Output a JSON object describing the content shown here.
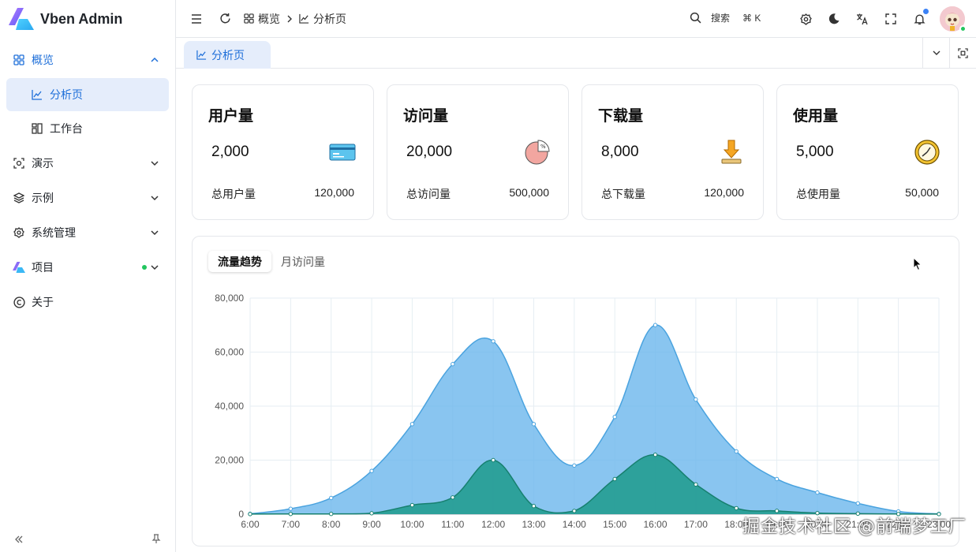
{
  "brand": {
    "title": "Vben Admin"
  },
  "sidebar": {
    "items": [
      {
        "label": "概览",
        "icon": "grid-icon",
        "open": true
      },
      {
        "label": "分析页",
        "icon": "chart-line-icon",
        "active": true
      },
      {
        "label": "工作台",
        "icon": "workspace-icon"
      },
      {
        "label": "演示",
        "icon": "demo-icon"
      },
      {
        "label": "示例",
        "icon": "layers-icon"
      },
      {
        "label": "系统管理",
        "icon": "gear-icon"
      },
      {
        "label": "项目",
        "icon": "vben-logo-icon"
      },
      {
        "label": "关于",
        "icon": "copyright-icon"
      }
    ]
  },
  "header": {
    "breadcrumb": [
      "概览",
      "分析页"
    ],
    "search_label": "搜索",
    "search_shortcut": "⌘ K"
  },
  "tabs": [
    {
      "label": "分析页"
    }
  ],
  "cards": [
    {
      "title": "用户量",
      "value": "2,000",
      "total_label": "总用户量",
      "total_value": "120,000",
      "icon": "card-icon"
    },
    {
      "title": "访问量",
      "value": "20,000",
      "total_label": "总访问量",
      "total_value": "500,000",
      "icon": "pie-icon"
    },
    {
      "title": "下载量",
      "value": "8,000",
      "total_label": "总下载量",
      "total_value": "120,000",
      "icon": "download-icon"
    },
    {
      "title": "使用量",
      "value": "5,000",
      "total_label": "总使用量",
      "total_value": "50,000",
      "icon": "clock-icon"
    }
  ],
  "chart_tabs": [
    "流量趋势",
    "月访问量"
  ],
  "chart_data": {
    "type": "area",
    "categories": [
      "6:00",
      "7:00",
      "8:00",
      "9:00",
      "10:00",
      "11:00",
      "12:00",
      "13:00",
      "14:00",
      "15:00",
      "16:00",
      "17:00",
      "18:00",
      "19:00",
      "20:00",
      "21:00",
      "22:00",
      "23:00"
    ],
    "series": [
      {
        "values": [
          111,
          2000,
          6000,
          16000,
          33333,
          55555,
          64000,
          33333,
          18000,
          36000,
          70000,
          42444,
          23222,
          13000,
          8000,
          4000,
          1000,
          100
        ],
        "color": "#6bb6ec"
      },
      {
        "values": [
          33,
          66,
          88,
          333,
          3333,
          6200,
          20000,
          3000,
          1200,
          13000,
          22000,
          11000,
          2221,
          1201,
          390,
          198,
          60,
          30
        ],
        "color": "#1d9a8c"
      }
    ],
    "ylim": [
      0,
      80000
    ],
    "yticks": [
      0,
      20000,
      40000,
      60000,
      80000
    ],
    "ytick_labels": [
      "0",
      "20,000",
      "40,000",
      "60,000",
      "80,000"
    ],
    "grid": true
  },
  "watermark": "掘金技术社区 @前端梦工厂"
}
